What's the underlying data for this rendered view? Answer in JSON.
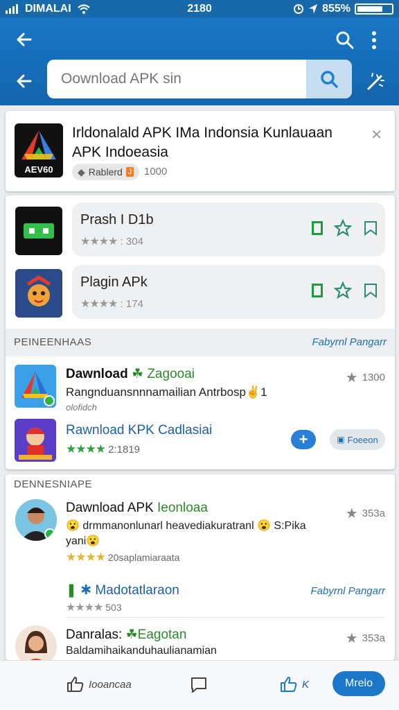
{
  "status_bar": {
    "carrier": "DIMALAI",
    "time": "2180",
    "battery": "855%"
  },
  "header": {
    "search": {
      "placeholder": "Oownload APK sin",
      "value": ""
    },
    "icons": [
      "back-arrow-icon",
      "search-icon",
      "more-vert-icon",
      "magic-wand-icon"
    ]
  },
  "featured": {
    "title": "Irldonalald APK IMa Indonsia Kunlauaan APK Indoeasia",
    "icon_label": "AEV60",
    "badge_label": "Rablerd",
    "badge_mark": "J",
    "count": "1000"
  },
  "apps": [
    {
      "name": "Prash I D1b",
      "stars": "★★★★",
      "rating": ": 304"
    },
    {
      "name": "Plagin APk",
      "stars": "★★★★",
      "rating": ": 174"
    }
  ],
  "section1": {
    "title": "PEINEENHAAS",
    "link": "Fabyrnl Pangarr",
    "items": [
      {
        "title": "Dawnload",
        "title_green": "☘ Zagooai",
        "subtitle": "Rangnduansnnnamailian Antrbosp✌1",
        "small": "olofidch",
        "count": "1300"
      },
      {
        "title": "Rawnload KPK Cadlasiai",
        "stars": "★★★★",
        "rating": "2:1819",
        "open_label": "Foeeon"
      }
    ]
  },
  "section2": {
    "title": "DENNESNIAPE",
    "link": "Fabyrnl Pangarr",
    "items": [
      {
        "title": "Dawnload APK",
        "title_green": "Ieonloaa",
        "subtitle_line1": "😮 drmmanonlunarl heavediakuratranl 😮 S:Pika",
        "subtitle_line2": "yani😮",
        "stars": "★★★★",
        "rating_text": "20saplamiaraata",
        "count": "353a"
      },
      {
        "title_green": "Madotatlaraon",
        "stars": "★★★★",
        "rating": "503"
      },
      {
        "title": "Danralas:",
        "title_green": "☘Eagotan",
        "subtitle": "Baldamihaikanduhaulianamian",
        "count": "353a"
      }
    ]
  },
  "bottom_bar": {
    "like_label": "Iooancaa",
    "share_label": "K",
    "cta_label": "Mrelo"
  },
  "colors": {
    "brand": "#1769aa",
    "accent": "#1d77c9",
    "green": "#2e9e3e"
  }
}
